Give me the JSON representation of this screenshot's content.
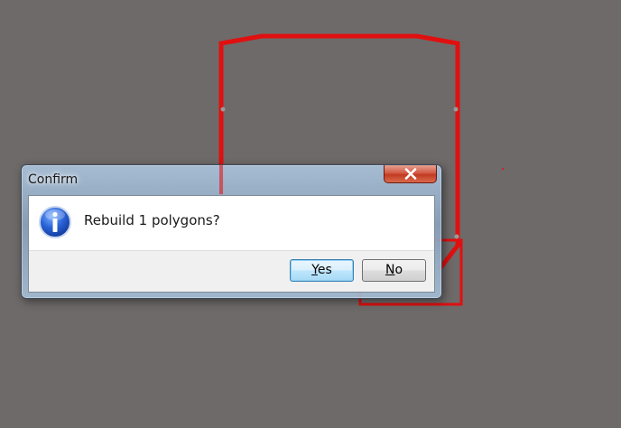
{
  "canvas": {
    "background": "#6e6a69",
    "outline_color": "#e01010"
  },
  "dialog": {
    "title": "Confirm",
    "close_icon": "close-icon",
    "message_icon": "info-icon",
    "message": "Rebuild 1 polygons?",
    "buttons": {
      "yes": {
        "mnemonic": "Y",
        "rest": "es",
        "is_default": true
      },
      "no": {
        "mnemonic": "N",
        "rest": "o",
        "is_default": false
      }
    }
  }
}
